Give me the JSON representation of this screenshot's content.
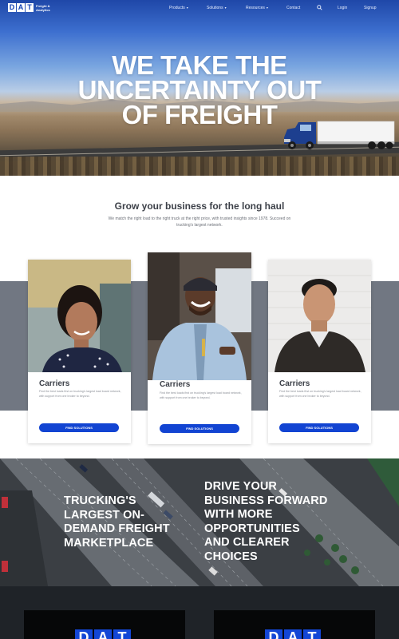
{
  "nav": {
    "logo_letters": [
      "D",
      "A",
      "T"
    ],
    "logo_sub": "Freight & Analytics",
    "items": [
      {
        "label": "Products",
        "dropdown": true
      },
      {
        "label": "Solutions",
        "dropdown": true
      },
      {
        "label": "Resources",
        "dropdown": true
      },
      {
        "label": "Contact",
        "dropdown": false
      }
    ],
    "search_icon": "search-icon",
    "login": "Login",
    "signup": "Signup"
  },
  "hero": {
    "title_lines": [
      "WE TAKE THE",
      "UNCERTAINTY OUT",
      "OF FREIGHT"
    ]
  },
  "intro": {
    "heading": "Grow your business for the long haul",
    "text": "We match the right load to the right truck at the right price, with trusted insights since 1978. Succeed on trucking's largest network."
  },
  "cards": [
    {
      "title": "Carriers",
      "text": "Find the best loads first on trucking's largest load board network, with support from one broker to beyond.",
      "button": "FIND SOLUTIONS",
      "photo": "woman-portrait"
    },
    {
      "title": "Carriers",
      "text": "Find the best loads first on trucking's largest load board network, with support from one broker to beyond.",
      "button": "FIND SOLUTIONS",
      "photo": "truck-driver-portrait"
    },
    {
      "title": "Carriers",
      "text": "Find the best loads first on trucking's largest load board network, with support from one broker to beyond.",
      "button": "FIND SOLUTIONS",
      "photo": "man-portrait"
    }
  ],
  "aerial": {
    "left_lines": [
      "TRUCKING'S",
      "LARGEST ON-",
      "DEMAND FREIGHT",
      "MARKETPLACE"
    ],
    "right_lines": [
      "DRIVE YOUR",
      "BUSINESS FORWARD",
      "WITH MORE",
      "OPPORTUNITIES",
      "AND CLEARER",
      "CHOICES"
    ]
  },
  "footer_promos": [
    {
      "logo_letters": [
        "D",
        "A",
        "T"
      ]
    },
    {
      "logo_letters": [
        "D",
        "A",
        "T"
      ]
    }
  ],
  "colors": {
    "brand_blue": "#1244d2",
    "band_gray": "#717782",
    "dark_footer": "#1f2328"
  }
}
